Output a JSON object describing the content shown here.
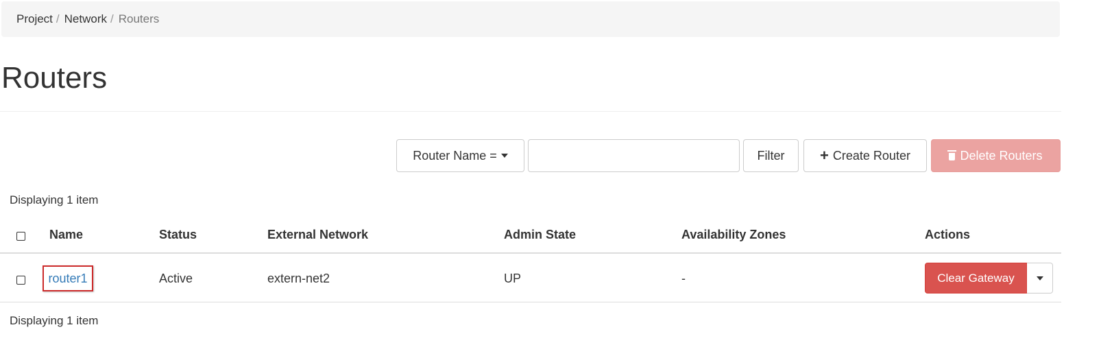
{
  "breadcrumb": {
    "items": [
      "Project",
      "Network"
    ],
    "current": "Routers",
    "separator": "/"
  },
  "page": {
    "title": "Routers"
  },
  "toolbar": {
    "filter_select_label": "Router Name =",
    "filter_input_value": "",
    "filter_label": "Filter",
    "create_label": "Create Router",
    "delete_label": "Delete Routers"
  },
  "table": {
    "count_text": "Displaying 1 item",
    "columns": [
      "Name",
      "Status",
      "External Network",
      "Admin State",
      "Availability Zones",
      "Actions"
    ],
    "rows": [
      {
        "name": "router1",
        "status": "Active",
        "external_network": "extern-net2",
        "admin_state": "UP",
        "availability_zones": "-",
        "action_label": "Clear Gateway"
      }
    ]
  },
  "colors": {
    "danger": "#d9534f",
    "danger_disabled": "#eba3a1",
    "link": "#337ab7",
    "highlight_border": "#cc2a2a"
  }
}
